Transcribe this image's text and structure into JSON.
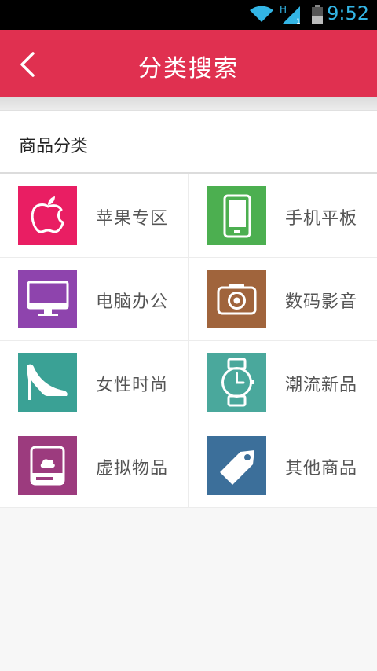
{
  "status_bar": {
    "time": "9:52",
    "network": "H",
    "sim_slot": "1"
  },
  "header": {
    "title": "分类搜索"
  },
  "section": {
    "title": "商品分类"
  },
  "categories": [
    {
      "label": "苹果专区",
      "icon": "apple-icon",
      "color": "#e91e63"
    },
    {
      "label": "手机平板",
      "icon": "phone-icon",
      "color": "#4caf50"
    },
    {
      "label": "电脑办公",
      "icon": "monitor-icon",
      "color": "#8e44ad"
    },
    {
      "label": "数码影音",
      "icon": "camera-icon",
      "color": "#a0643c"
    },
    {
      "label": "女性时尚",
      "icon": "high-heel-icon",
      "color": "#3aa195"
    },
    {
      "label": "潮流新品",
      "icon": "watch-icon",
      "color": "#4aa89c"
    },
    {
      "label": "虚拟物品",
      "icon": "storage-drive-icon",
      "color": "#9c3b7e"
    },
    {
      "label": "其他商品",
      "icon": "tag-icon",
      "color": "#3c6f9a"
    }
  ],
  "colors": {
    "app_bar": "#e03050",
    "status_time": "#33b5e5"
  }
}
